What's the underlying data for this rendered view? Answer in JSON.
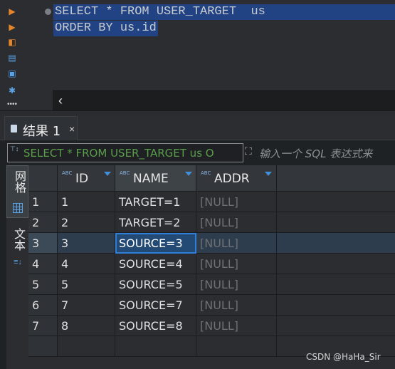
{
  "editor": {
    "line1": "SELECT * FROM USER_TARGET  us",
    "line2": "ORDER BY us.id"
  },
  "left_toolbar": [
    "run-icon",
    "run-script-icon",
    "explain-icon",
    "export-icon",
    "terminal-icon",
    "settings-icon",
    "more-icon"
  ],
  "results": {
    "tab_label": "结果 1",
    "tab_close": "×",
    "filter_text": "SELECT * FROM USER_TARGET us O",
    "filter_hint": "输入一个 SQL 表达式来",
    "side_tabs": {
      "grid": "网格",
      "text": "文本"
    },
    "columns": [
      "ID",
      "NAME",
      "ADDR"
    ],
    "type_badge": "ABC",
    "rows": [
      {
        "num": "1",
        "id": "1",
        "name": "TARGET=1",
        "addr": "[NULL]"
      },
      {
        "num": "2",
        "id": "2",
        "name": "TARGET=2",
        "addr": "[NULL]"
      },
      {
        "num": "3",
        "id": "3",
        "name": "SOURCE=3",
        "addr": "[NULL]"
      },
      {
        "num": "4",
        "id": "4",
        "name": "SOURCE=4",
        "addr": "[NULL]"
      },
      {
        "num": "5",
        "id": "5",
        "name": "SOURCE=5",
        "addr": "[NULL]"
      },
      {
        "num": "6",
        "id": "7",
        "name": "SOURCE=7",
        "addr": "[NULL]"
      },
      {
        "num": "7",
        "id": "8",
        "name": "SOURCE=8",
        "addr": "[NULL]"
      }
    ],
    "selected_row": 3
  },
  "watermark": "CSDN @HaHa_Sir",
  "colors": {
    "background": "#1f2224",
    "selection": "#214283",
    "accent": "#2f7fd6",
    "filter_text": "#5a9d4a"
  }
}
